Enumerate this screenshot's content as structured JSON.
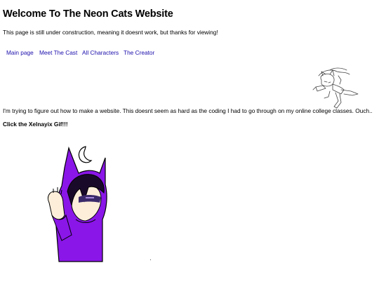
{
  "page": {
    "title": "Welcome To The Neon Cats Website",
    "intro": "This page is still under construction, meaning it doesnt work, but thanks for viewing!",
    "body_text": "I'm trying to figure out how to make a website. This doesnt seem as hard as the coding I had to go through on my online college classes. Ouch..",
    "cta": "Click the Xelnayix Gif!!!"
  },
  "nav": {
    "items": [
      {
        "label": "Main page"
      },
      {
        "label": "Meet The Cast"
      },
      {
        "label": "All Characters"
      },
      {
        "label": "The Creator"
      }
    ]
  },
  "colors": {
    "link": "#1a0dab",
    "character_purple": "#8a16e8"
  },
  "images": {
    "doodle": "sketch-cat-character",
    "gif": "xelnayix-purple-hooded-cat-character"
  }
}
